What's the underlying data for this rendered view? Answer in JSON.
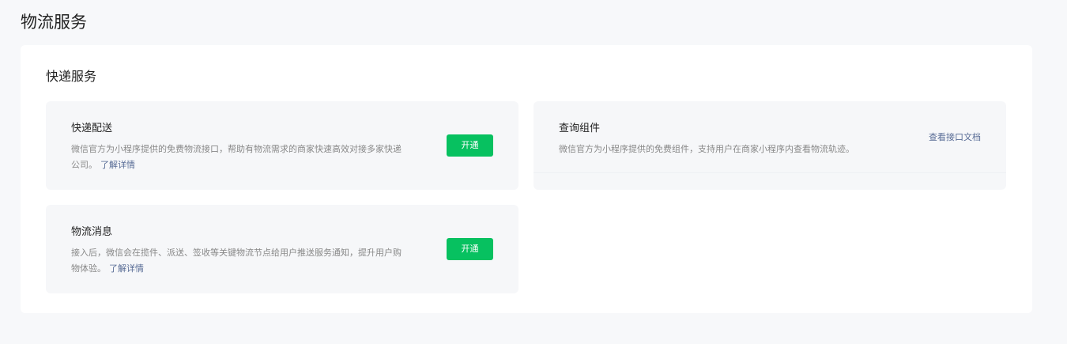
{
  "page": {
    "title": "物流服务"
  },
  "section": {
    "title": "快递服务"
  },
  "cards": [
    {
      "title": "快递配送",
      "description": "微信官方为小程序提供的免费物流接口，帮助有物流需求的商家快速高效对接多家快递公司。",
      "link_label": "了解详情",
      "action_label": "开通"
    },
    {
      "title": "查询组件",
      "description": "微信官方为小程序提供的免费组件，支持用户在商家小程序内查看物流轨迹。",
      "action_label": "查看接口文档"
    },
    {
      "title": "物流消息",
      "description": "接入后，微信会在揽件、派送、签收等关键物流节点给用户推送服务通知，提升用户购物体验。",
      "link_label": "了解详情",
      "action_label": "开通"
    }
  ],
  "colors": {
    "page_bg": "#f7f8fa",
    "panel_bg": "#ffffff",
    "card_bg": "#f6f7f9",
    "accent_green": "#07c160",
    "link_blue": "#576b95"
  }
}
